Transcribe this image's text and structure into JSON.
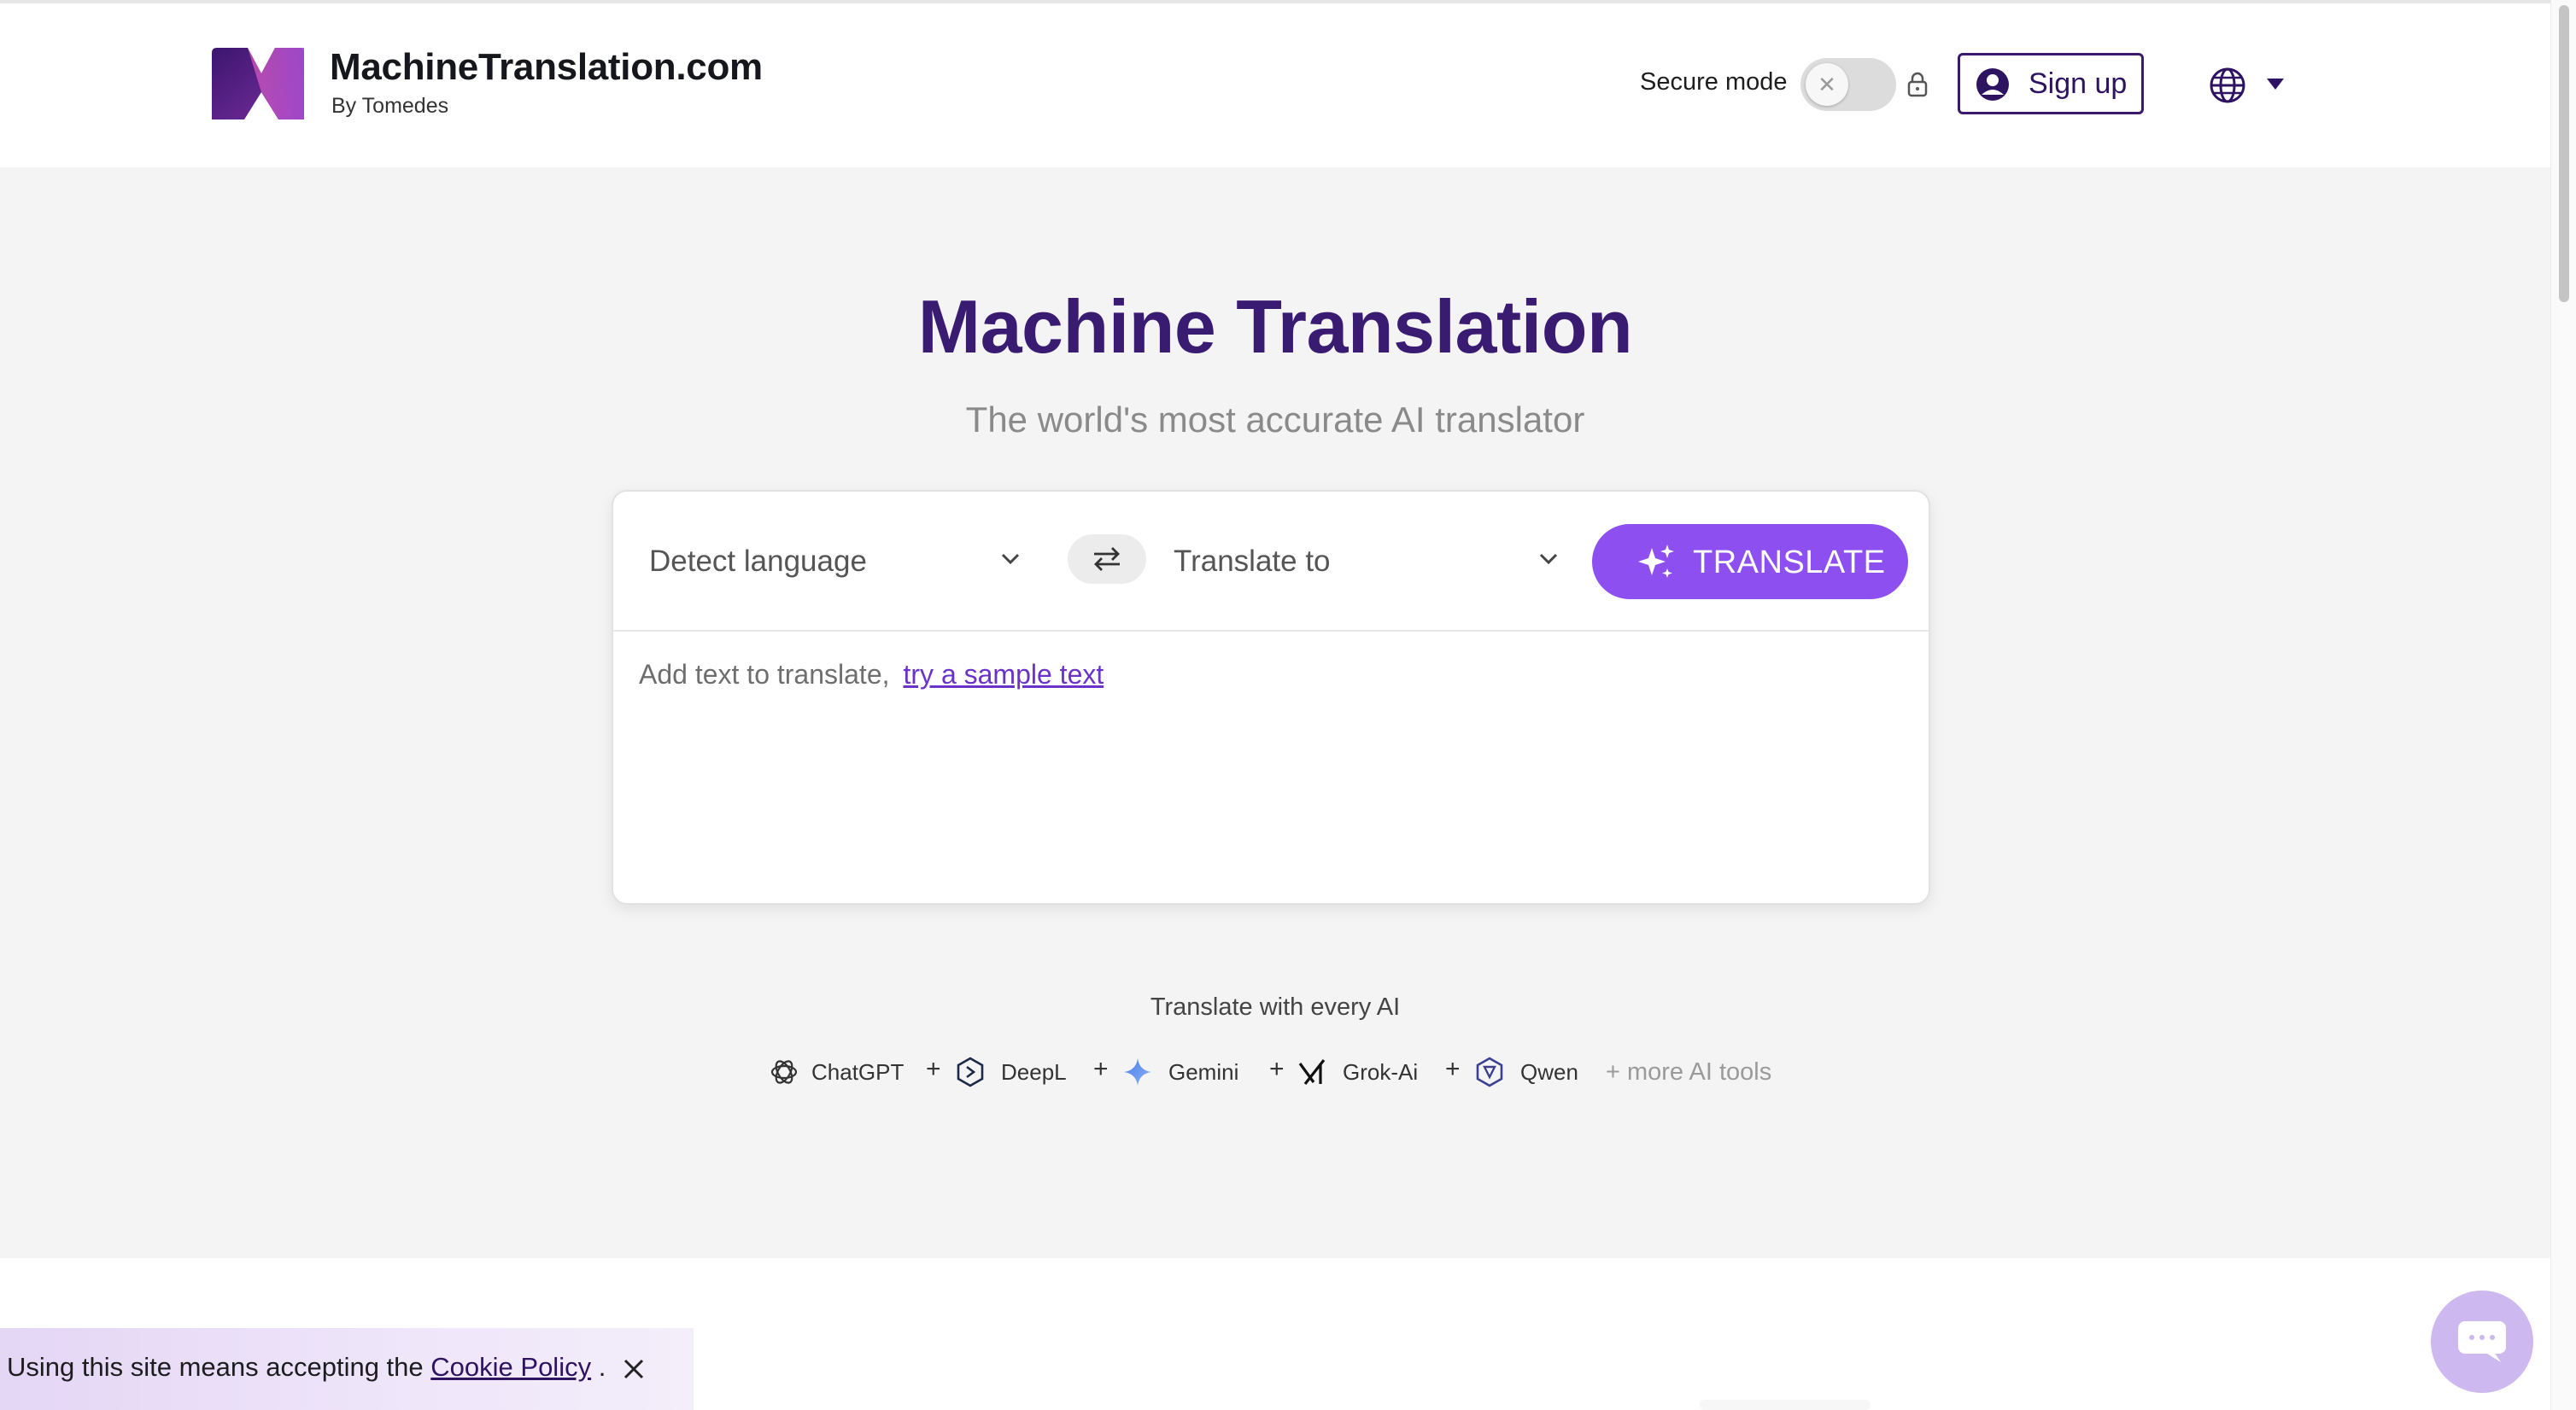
{
  "header": {
    "brand_name": "MachineTranslation.com",
    "brand_sub": "By Tomedes",
    "secure_mode_label": "Secure mode",
    "secure_mode_on": false,
    "signup_label": "Sign up",
    "icons": [
      "logo",
      "lock-icon",
      "user-icon",
      "globe-icon",
      "caret-down-icon"
    ]
  },
  "hero": {
    "title": "Machine Translation",
    "subtitle": "The world's most accurate AI translator"
  },
  "translator": {
    "source_language": "Detect language",
    "target_language": "Translate to",
    "translate_button": "TRANSLATE",
    "input_placeholder": "Add text to translate,",
    "sample_link": "try a sample text"
  },
  "ai_tools": {
    "heading": "Translate with every AI",
    "items": [
      {
        "name": "ChatGPT",
        "icon": "chatgpt-icon"
      },
      {
        "name": "DeepL",
        "icon": "deepl-icon"
      },
      {
        "name": "Gemini",
        "icon": "gemini-icon"
      },
      {
        "name": "Grok-Ai",
        "icon": "grok-icon"
      },
      {
        "name": "Qwen",
        "icon": "qwen-icon"
      }
    ],
    "separator": "+",
    "more_label": "+ more AI tools"
  },
  "cookie": {
    "text_before": "Using this site means accepting the",
    "link": "Cookie Policy",
    "text_after": "."
  },
  "colors": {
    "brand_purple": "#3a1b72",
    "button_purple": "#8d4ff0",
    "hero_bg": "#f4f4f4"
  }
}
